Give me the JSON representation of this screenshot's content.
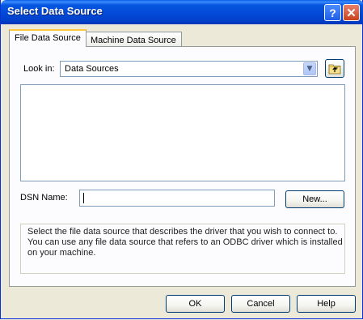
{
  "window": {
    "title": "Select Data Source",
    "help_glyph": "?",
    "close_glyph": "✕"
  },
  "tabs": [
    {
      "label": "File Data Source",
      "active": true
    },
    {
      "label": "Machine Data Source",
      "active": false
    }
  ],
  "look_in": {
    "label": "Look in:",
    "value": "Data Sources"
  },
  "file_list": {
    "items": []
  },
  "dsn": {
    "label": "DSN Name:",
    "value": "",
    "new_button": "New..."
  },
  "description": {
    "lines": [
      "Select the file data source that describes the driver that you wish to connect to.",
      "You can use any file data source that refers to an ODBC driver which is installed",
      "on your machine."
    ]
  },
  "buttons": {
    "ok": "OK",
    "cancel": "Cancel",
    "help": "Help"
  },
  "colors": {
    "titlebar": "#0349d8",
    "dialog_bg": "#ece9d8",
    "active_tab_accent": "#ffc83c",
    "button_border": "#003c74"
  }
}
